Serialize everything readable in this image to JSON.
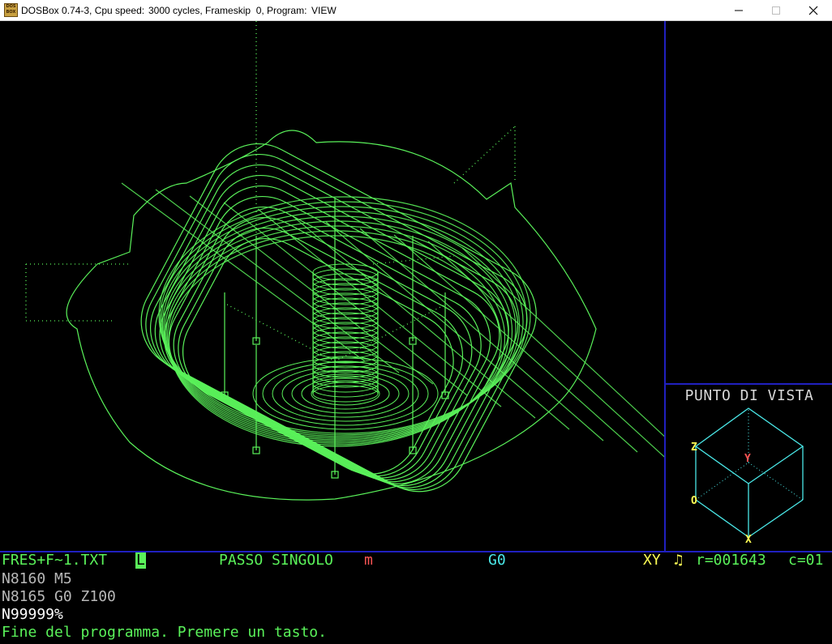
{
  "window": {
    "title_app": "DOSBox 0.74-3, Cpu speed:",
    "title_cycles": "3000 cycles, Frameskip  0, Program:",
    "title_program": "VIEW",
    "icon_text": "DOS BOX"
  },
  "viewpoint": {
    "title": "PUNTO DI VISTA",
    "axis_z": "Z",
    "axis_y": "Y",
    "axis_o": "O",
    "axis_x": "X"
  },
  "status_bar": {
    "filename": "FRES+F~1.TXT",
    "mode_key": "L",
    "step_mode": "PASSO SINGOLO",
    "step_flag": "m",
    "gcode": "G0",
    "plane": "XY",
    "tool_glyph": "♫",
    "row_counter": "r=001643",
    "col_counter": "c=01"
  },
  "program_lines": [
    "N8160 M5",
    "N8165 G0 Z100",
    "N99999%"
  ],
  "message": "Fine del programma. Premere un tasto.",
  "colors": {
    "wireframe": "#5af25a",
    "cube": "#4ae8e8",
    "divider": "#2020c0",
    "axis_label": "#ffff55",
    "y_label": "#ff5555"
  }
}
